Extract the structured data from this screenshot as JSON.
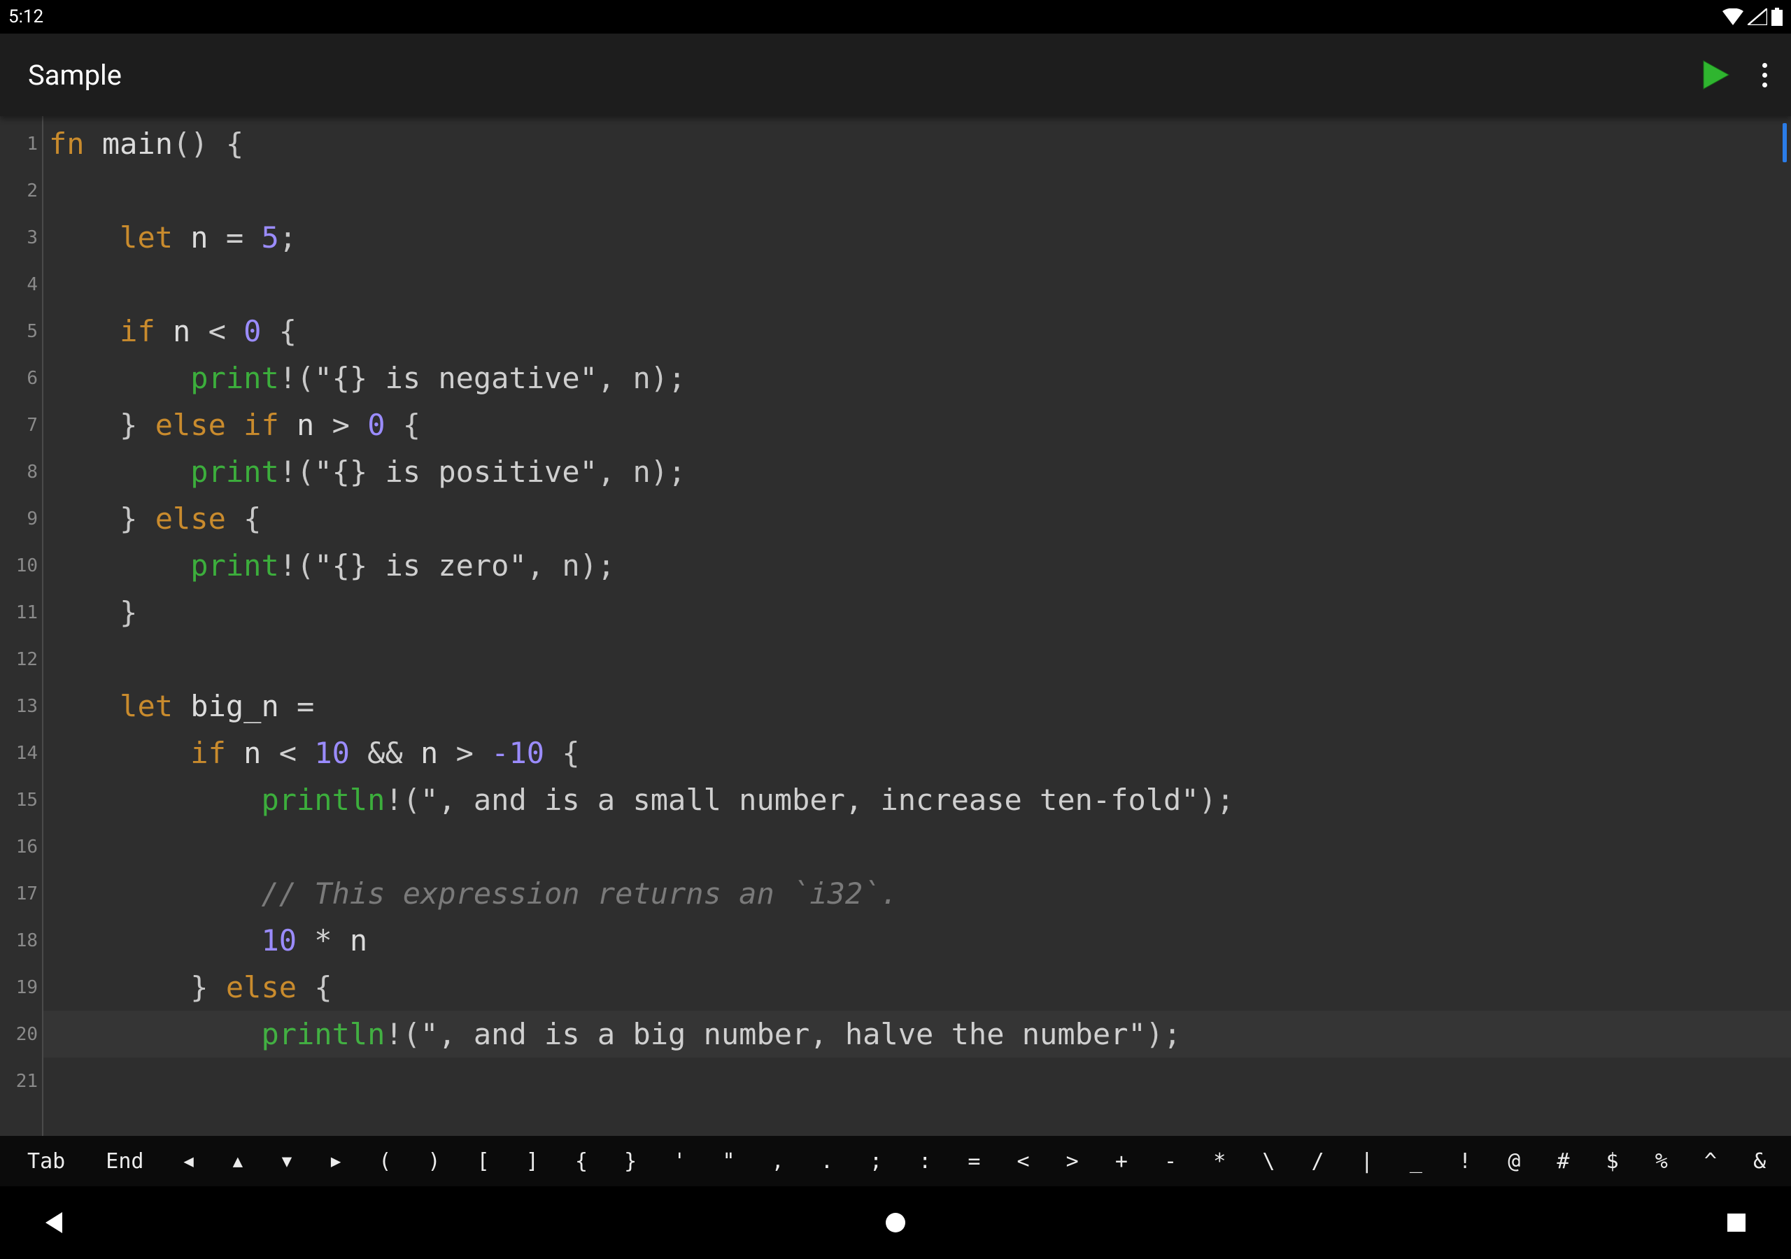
{
  "status": {
    "time": "5:12"
  },
  "appbar": {
    "title": "Sample"
  },
  "code": {
    "lines": [
      [
        [
          "kw",
          "fn"
        ],
        [
          "id",
          " main"
        ],
        [
          "punc",
          "() {"
        ]
      ],
      [],
      [
        [
          "id",
          "    "
        ],
        [
          "kw",
          "let"
        ],
        [
          "id",
          " n "
        ],
        [
          "op",
          "= "
        ],
        [
          "num",
          "5"
        ],
        [
          "punc",
          ";"
        ]
      ],
      [],
      [
        [
          "id",
          "    "
        ],
        [
          "kw",
          "if"
        ],
        [
          "id",
          " n "
        ],
        [
          "op",
          "< "
        ],
        [
          "num",
          "0"
        ],
        [
          "punc",
          " {"
        ]
      ],
      [
        [
          "id",
          "        "
        ],
        [
          "mac",
          "print"
        ],
        [
          "punc",
          "!("
        ],
        [
          "str",
          "\"{} is negative\""
        ],
        [
          "punc",
          ", n);"
        ]
      ],
      [
        [
          "id",
          "    "
        ],
        [
          "punc",
          "} "
        ],
        [
          "kw",
          "else if"
        ],
        [
          "id",
          " n "
        ],
        [
          "op",
          "> "
        ],
        [
          "num",
          "0"
        ],
        [
          "punc",
          " {"
        ]
      ],
      [
        [
          "id",
          "        "
        ],
        [
          "mac",
          "print"
        ],
        [
          "punc",
          "!("
        ],
        [
          "str",
          "\"{} is positive\""
        ],
        [
          "punc",
          ", n);"
        ]
      ],
      [
        [
          "id",
          "    "
        ],
        [
          "punc",
          "} "
        ],
        [
          "kw",
          "else"
        ],
        [
          "punc",
          " {"
        ]
      ],
      [
        [
          "id",
          "        "
        ],
        [
          "mac",
          "print"
        ],
        [
          "punc",
          "!("
        ],
        [
          "str",
          "\"{} is zero\""
        ],
        [
          "punc",
          ", n);"
        ]
      ],
      [
        [
          "id",
          "    "
        ],
        [
          "punc",
          "}"
        ]
      ],
      [],
      [
        [
          "id",
          "    "
        ],
        [
          "kw",
          "let"
        ],
        [
          "id",
          " big_n "
        ],
        [
          "op",
          "="
        ]
      ],
      [
        [
          "id",
          "        "
        ],
        [
          "kw",
          "if"
        ],
        [
          "id",
          " n "
        ],
        [
          "op",
          "< "
        ],
        [
          "num",
          "10"
        ],
        [
          "op",
          " && "
        ],
        [
          "id",
          "n "
        ],
        [
          "op",
          "> "
        ],
        [
          "num",
          "-10"
        ],
        [
          "punc",
          " {"
        ]
      ],
      [
        [
          "id",
          "            "
        ],
        [
          "mac",
          "println"
        ],
        [
          "punc",
          "!("
        ],
        [
          "str",
          "\", and is a small number, increase ten-fold\""
        ],
        [
          "punc",
          ");"
        ]
      ],
      [],
      [
        [
          "id",
          "            "
        ],
        [
          "cmt",
          "// This expression returns an `i32`."
        ]
      ],
      [
        [
          "id",
          "            "
        ],
        [
          "num",
          "10"
        ],
        [
          "op",
          " * "
        ],
        [
          "id",
          "n"
        ]
      ],
      [
        [
          "id",
          "        "
        ],
        [
          "punc",
          "} "
        ],
        [
          "kw",
          "else"
        ],
        [
          "punc",
          " {"
        ]
      ],
      [
        [
          "id",
          "            "
        ],
        [
          "mac",
          "println"
        ],
        [
          "punc",
          "!("
        ],
        [
          "str",
          "\", and is a big number, halve the number\""
        ],
        [
          "punc",
          ");"
        ]
      ],
      []
    ]
  },
  "symbols": {
    "items": [
      "Tab",
      "End",
      "◀",
      "▲",
      "▼",
      "▶",
      "(",
      ")",
      "[",
      "]",
      "{",
      "}",
      "'",
      "\"",
      ",",
      ".",
      ";",
      ":",
      "=",
      "<",
      ">",
      "+",
      "-",
      "*",
      "\\",
      "/",
      "|",
      "_",
      "!",
      "@",
      "#",
      "$",
      "%",
      "^",
      "&"
    ]
  }
}
